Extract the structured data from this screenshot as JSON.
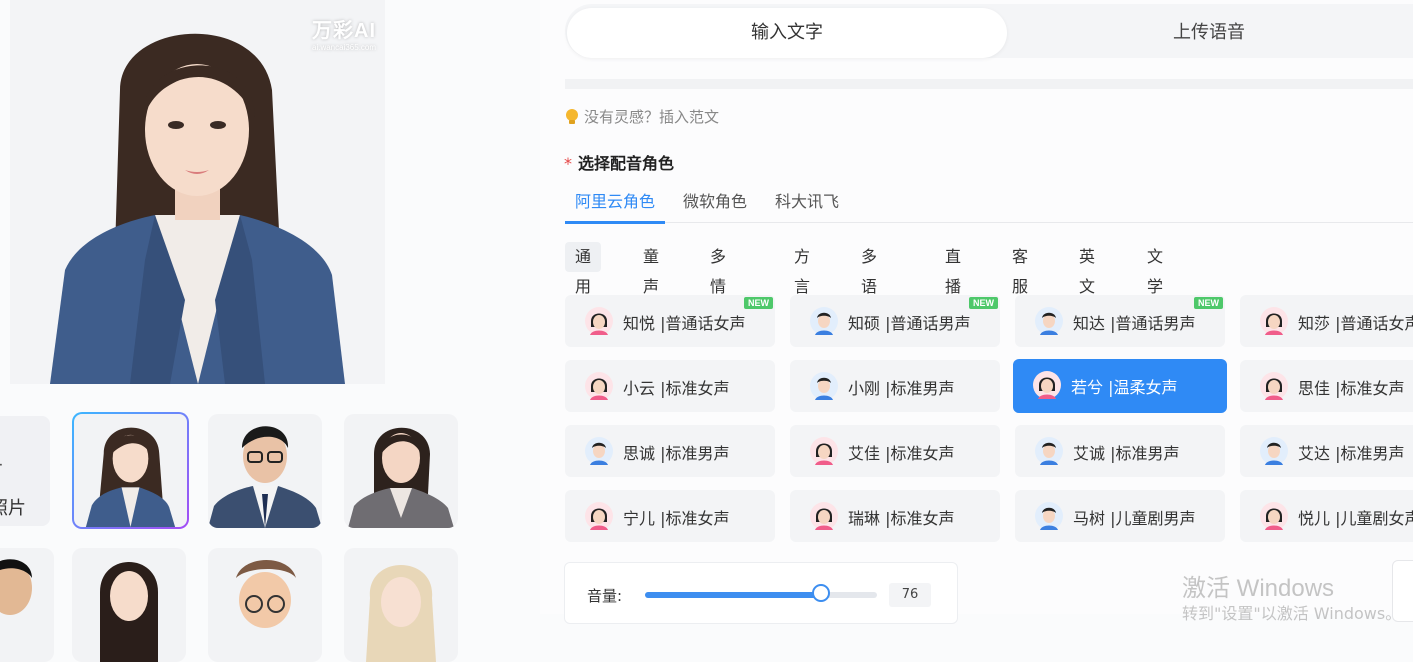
{
  "watermark": {
    "brand": "万彩AI",
    "sub": "ai.wancai365.com"
  },
  "upload": {
    "plus": "+",
    "label": "照片"
  },
  "mode_tabs": [
    "输入文字",
    "上传语音"
  ],
  "hint": "没有灵感？插入范文",
  "section_title": "选择配音角色",
  "required_mark": "*",
  "vendor_tabs": [
    "阿里云角色",
    "微软角色",
    "科大讯飞"
  ],
  "categories": [
    "通用",
    "童声",
    "多情感",
    "方言",
    "多语种",
    "直播",
    "客服",
    "英文",
    "文学"
  ],
  "voices": [
    {
      "name": "知悦 |普通话女声",
      "gender": "female",
      "new": "NEW"
    },
    {
      "name": "知硕 |普通话男声",
      "gender": "male",
      "new": "NEW"
    },
    {
      "name": "知达 |普通话男声",
      "gender": "male",
      "new": "NEW"
    },
    {
      "name": "知莎 |普通话女声",
      "gender": "female"
    },
    {
      "name": "小云 |标准女声",
      "gender": "female"
    },
    {
      "name": "小刚 |标准男声",
      "gender": "male"
    },
    {
      "name": "若兮 |温柔女声",
      "gender": "female",
      "active": true
    },
    {
      "name": "思佳 |标准女声",
      "gender": "female"
    },
    {
      "name": "思诚 |标准男声",
      "gender": "male"
    },
    {
      "name": "艾佳 |标准女声",
      "gender": "female"
    },
    {
      "name": "艾诚 |标准男声",
      "gender": "male"
    },
    {
      "name": "艾达 |标准男声",
      "gender": "male"
    },
    {
      "name": "宁儿 |标准女声",
      "gender": "female"
    },
    {
      "name": "瑞琳 |标准女声",
      "gender": "female"
    },
    {
      "name": "马树 |儿童剧男声",
      "gender": "male"
    },
    {
      "name": "悦儿 |儿童剧女声",
      "gender": "female"
    }
  ],
  "volume": {
    "label": "音量:",
    "value": "76",
    "level": 0.76
  },
  "windows": {
    "line1": "激活 Windows",
    "line2": "转到\"设置\"以激活 Windows。"
  },
  "colors": {
    "accent": "#2f8af5",
    "new_badge": "#4ec86a"
  }
}
